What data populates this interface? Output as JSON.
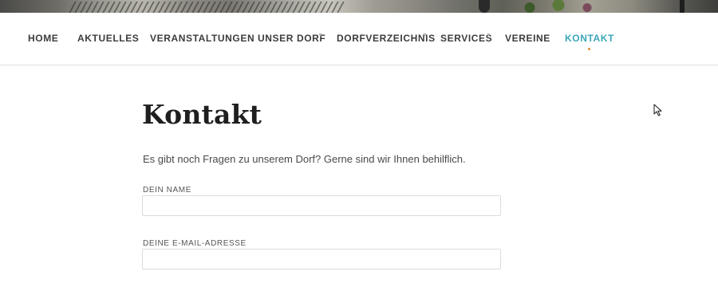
{
  "nav": {
    "items": [
      {
        "label": "HOME",
        "has_submenu": false,
        "active": false
      },
      {
        "label": "AKTUELLES",
        "has_submenu": false,
        "active": false
      },
      {
        "label": "VERANSTALTUNGEN",
        "has_submenu": false,
        "active": false
      },
      {
        "label": "UNSER DORF",
        "has_submenu": true,
        "active": false
      },
      {
        "label": "DORFVERZEICHNIS",
        "has_submenu": true,
        "active": false
      },
      {
        "label": "SERVICES",
        "has_submenu": true,
        "active": false
      },
      {
        "label": "VEREINE",
        "has_submenu": false,
        "active": false
      },
      {
        "label": "KONTAKT",
        "has_submenu": false,
        "active": true
      }
    ],
    "active_color": "#3aa7b9",
    "indicator_color": "#e58a2f",
    "caret_icon": "chevron-down-icon"
  },
  "main": {
    "title": "Kontakt",
    "intro": "Es gibt noch Fragen zu unserem Dorf? Gerne sind wir Ihnen behilflich.",
    "form": {
      "name_label": "DEIN NAME",
      "name_value": "",
      "email_label": "DEINE E-MAIL-ADRESSE",
      "email_value": ""
    }
  },
  "cursor_icon": "mouse-pointer-icon"
}
